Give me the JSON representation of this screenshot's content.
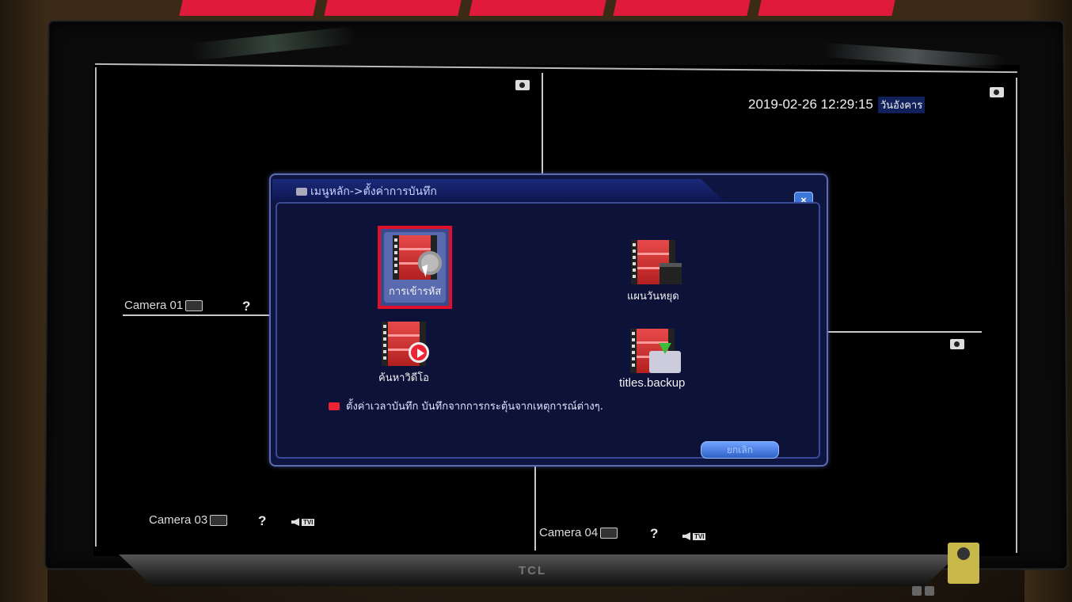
{
  "dvr": {
    "datetime": "2019-02-26 12:29:15",
    "weekday": "วันอังคาร",
    "cameras": {
      "cam1": "Camera 01",
      "cam3": "Camera 03",
      "cam4": "Camera 04"
    },
    "unknown_mark": "?",
    "audio_badge": "TVI"
  },
  "dialog": {
    "breadcrumb": "เมนูหลัก->ตั้งค่าการบันทึก",
    "close_label": "×",
    "items": [
      {
        "label": "การเข้ารหัส",
        "icon": "settings-gear-icon",
        "selected": true
      },
      {
        "label": "แผนวันหยุด",
        "icon": "holiday-plan-icon",
        "selected": false
      },
      {
        "label": "ค้นหาวิดีโอ",
        "icon": "video-search-icon",
        "selected": false
      },
      {
        "label": "titles.backup",
        "icon": "backup-icon",
        "selected": false
      }
    ],
    "hint": "ตั้งค่าเวลาบันทึก บันทึกจากการกระตุ้นจากเหตุการณ์ต่างๆ.",
    "back_label": "ยกเลิก"
  },
  "tv": {
    "brand": "TCL"
  },
  "colors": {
    "selection": "#e0102a",
    "dialog_bg": "#0e1540",
    "button_blue": "#3e76d8"
  }
}
